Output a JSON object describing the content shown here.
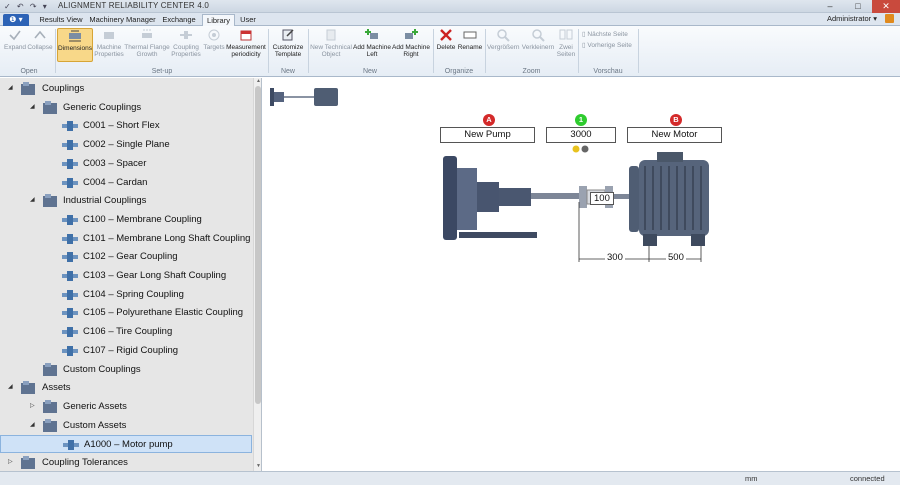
{
  "app": {
    "title": "ALIGNMENT RELIABILITY CENTER 4.0"
  },
  "quick_access": "✓ ↶ ↷ ▾",
  "file_tab": "❶ ▾",
  "tabs": [
    "Results View",
    "Machinery Manager",
    "Exchange",
    "Library",
    "User"
  ],
  "active_tab": "Library",
  "user": {
    "name": "Administrator ▾"
  },
  "window_buttons": {
    "minimize": "–",
    "maximize": "□",
    "close": "✕"
  },
  "ribbon": {
    "buttons": [
      {
        "key": "expand",
        "label": "Expand",
        "enabled": false,
        "icon": "check-icon"
      },
      {
        "key": "collapse",
        "label": "Collapse",
        "enabled": false,
        "icon": "chevron-up-icon"
      },
      {
        "key": "dimensions",
        "label": "Dimensions",
        "enabled": true,
        "active": true,
        "icon": "dimensions-icon"
      },
      {
        "key": "machine_properties",
        "label": "Machine Properties",
        "enabled": false,
        "icon": "machine-icon"
      },
      {
        "key": "thermal_growth",
        "label": "Thermal Flange Growth",
        "enabled": false,
        "icon": "thermal-icon"
      },
      {
        "key": "coupling_properties",
        "label": "Coupling Properties",
        "enabled": false,
        "icon": "coupling-icon"
      },
      {
        "key": "targets",
        "label": "Targets",
        "enabled": false,
        "icon": "target-icon"
      },
      {
        "key": "measurement_periodicity",
        "label": "Measurement periodicity",
        "enabled": true,
        "icon": "calendar-icon"
      },
      {
        "key": "customize_template",
        "label": "Customize Template",
        "enabled": true,
        "icon": "template-icon"
      },
      {
        "key": "new_technical_object",
        "label": "New Technical Object",
        "enabled": false,
        "icon": "new-object-icon"
      },
      {
        "key": "add_machine_left",
        "label": "Add Machine Left",
        "enabled": true,
        "icon": "add-left-icon"
      },
      {
        "key": "add_machine_right",
        "label": "Add Machine Right",
        "enabled": true,
        "icon": "add-right-icon"
      },
      {
        "key": "delete",
        "label": "Delete",
        "enabled": true,
        "icon": "delete-icon"
      },
      {
        "key": "rename",
        "label": "Rename",
        "enabled": true,
        "icon": "rename-icon"
      },
      {
        "key": "zoom_in",
        "label": "Vergrößern",
        "enabled": false,
        "icon": "zoom-in-icon"
      },
      {
        "key": "zoom_out",
        "label": "Verkleinern",
        "enabled": false,
        "icon": "zoom-out-icon"
      },
      {
        "key": "two_pages",
        "label": "Zwei Seiten",
        "enabled": false,
        "icon": "two-pages-icon"
      },
      {
        "key": "next_page",
        "label": "Nächste Seite",
        "enabled": false,
        "icon": "next-page-icon"
      },
      {
        "key": "prev_page",
        "label": "Vorherige Seite",
        "enabled": false,
        "icon": "prev-page-icon"
      }
    ],
    "groups": [
      "Open",
      "Set-up",
      "New",
      "New",
      "Organize",
      "Zoom",
      "Vorschau"
    ]
  },
  "tree": [
    {
      "label": "Couplings",
      "level": 0,
      "expander": "◢",
      "icon": "couplings-folder-icon"
    },
    {
      "label": "Generic Couplings",
      "level": 1,
      "expander": "◢",
      "icon": "generic-couplings-icon"
    },
    {
      "label": "C001 – Short Flex",
      "level": 2,
      "icon": "short-flex-coupling-icon"
    },
    {
      "label": "C002 – Single Plane",
      "level": 2,
      "icon": "single-plane-coupling-icon"
    },
    {
      "label": "C003 – Spacer",
      "level": 2,
      "icon": "spacer-coupling-icon"
    },
    {
      "label": "C004 – Cardan",
      "level": 2,
      "icon": "cardan-coupling-icon"
    },
    {
      "label": "Industrial Couplings",
      "level": 1,
      "expander": "◢",
      "icon": "industrial-couplings-icon"
    },
    {
      "label": "C100 – Membrane Coupling",
      "level": 2,
      "icon": "membrane-coupling-icon"
    },
    {
      "label": "C101 – Membrane Long Shaft Coupling",
      "level": 2,
      "icon": "membrane-long-shaft-coupling-icon"
    },
    {
      "label": "C102 – Gear Coupling",
      "level": 2,
      "icon": "gear-coupling-icon"
    },
    {
      "label": "C103 – Gear Long Shaft Coupling",
      "level": 2,
      "icon": "gear-long-shaft-coupling-icon"
    },
    {
      "label": "C104 – Spring Coupling",
      "level": 2,
      "icon": "spring-coupling-icon"
    },
    {
      "label": "C105 – Polyurethane Elastic Coupling",
      "level": 2,
      "icon": "polyurethane-coupling-icon"
    },
    {
      "label": "C106 – Tire Coupling",
      "level": 2,
      "icon": "tire-coupling-icon"
    },
    {
      "label": "C107 – Rigid Coupling",
      "level": 2,
      "icon": "rigid-coupling-icon"
    },
    {
      "label": "Custom Couplings",
      "level": 1,
      "icon": "custom-couplings-icon"
    },
    {
      "label": "Assets",
      "level": 0,
      "expander": "◢",
      "icon": "assets-folder-icon"
    },
    {
      "label": "Generic Assets",
      "level": 1,
      "expander": "▷",
      "icon": "generic-assets-icon"
    },
    {
      "label": "Custom Assets",
      "level": 1,
      "expander": "◢",
      "icon": "custom-assets-icon"
    },
    {
      "label": "A1000 – Motor pump",
      "level": 2,
      "icon": "motor-pump-asset-icon",
      "selected": true
    },
    {
      "label": "Coupling Tolerances",
      "level": 0,
      "expander": "▷",
      "icon": "tolerances-folder-icon"
    }
  ],
  "diagram": {
    "machine_a": {
      "badge": "A",
      "name": "New Pump",
      "color": "#d42a2a"
    },
    "coupling": {
      "badge": "1",
      "rpm": "3000",
      "color": "#2ecc2e",
      "spacer_length": "100"
    },
    "machine_b": {
      "badge": "B",
      "name": "New Motor",
      "color": "#d42a2a"
    },
    "dimensions": [
      "300",
      "500"
    ]
  },
  "status": {
    "unit": "mm",
    "connection": "connected"
  }
}
